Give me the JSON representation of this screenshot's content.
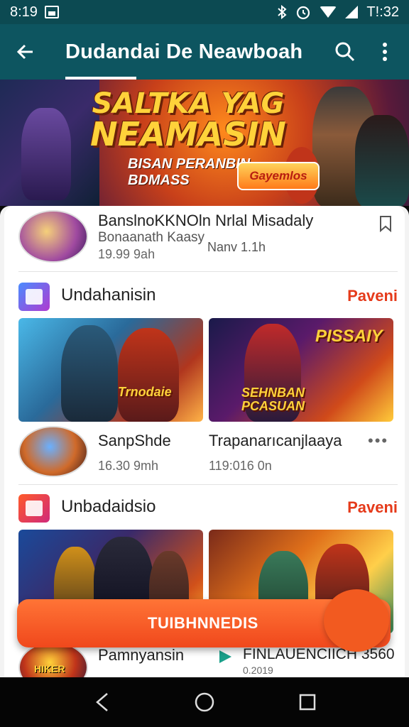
{
  "status_bar": {
    "time": "8:19",
    "clock_right": "T!:32",
    "icons": [
      "screenshot-icon",
      "bluetooth-icon",
      "alarm-icon",
      "wifi-icon",
      "signal-icon"
    ]
  },
  "app_bar": {
    "title": "Dudandai De Neawboah",
    "back_icon": "arrow-back-icon",
    "search_icon": "search-icon",
    "more_icon": "more-vert-icon",
    "color": "#0d5560"
  },
  "banner": {
    "title_line1": "SALTKA YAG",
    "title_line2": "NEAMASIN",
    "subtitle_line1": "BISAN PERANBIN",
    "subtitle_line2": "BDMASS",
    "badge": "Gayemlos"
  },
  "featured": {
    "title": "BanslnoKKNOln Nrlal Misadaly",
    "subtitle": "Bonaanath Kaasy",
    "time": "19.99 9ah",
    "meta": "Nanv 1.1h",
    "bookmark_icon": "bookmark-icon"
  },
  "sections": [
    {
      "title": "Undahanisin",
      "action": "Paveni",
      "thumb_labels": [
        "Trnodaie",
        "PISSAIY",
        "SEHNBAN PCASUAN"
      ],
      "items": [
        {
          "title": "SanpShde",
          "time": "16.30 9mh"
        },
        {
          "title": "Trapanarıcanjlaaya",
          "time": "119:016 0n"
        }
      ]
    },
    {
      "title": "Unbadaidsio",
      "action": "Paveni",
      "items": [
        {
          "title": "Pamnyansin",
          "badge": "HIKER"
        },
        {
          "title": "FINLAUENCIICH 3560",
          "sub": "0.2019"
        }
      ]
    }
  ],
  "cta": {
    "label": "TUIBHNNEDIS",
    "color": "#f0481c"
  },
  "nav": {
    "back_icon": "nav-back-icon",
    "home_icon": "nav-home-icon",
    "recents_icon": "nav-recents-icon"
  }
}
